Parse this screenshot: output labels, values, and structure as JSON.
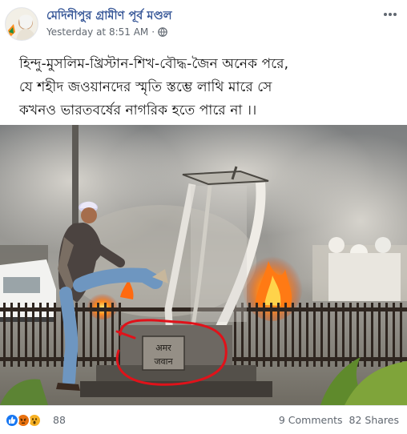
{
  "post": {
    "page_name": "মেদিনীপুর গ্রামীণ পূর্ব মণ্ডল",
    "timestamp": "Yesterday at 8:51 AM",
    "separator": "·",
    "audience_icon": "globe-icon",
    "menu_icon": "more-options-icon"
  },
  "banner": {
    "lines": [
      "হিন্দু-মুসলিম-খ্রিস্টান-শিখ-বৌদ্ধ-জৈন অনেক পরে,",
      "যে শহীদ জওয়ানদের স্মৃতি স্তম্ভে লাথি মারে সে",
      "কখনও ভারতবর্ষের নাগরিক হতে পারে না ।।"
    ]
  },
  "photo": {
    "plaque_line1": "अमर",
    "plaque_line2": "जवान"
  },
  "footer": {
    "reaction_icons": [
      "like-icon",
      "angry-icon",
      "wow-icon"
    ],
    "reaction_count": "88",
    "comments": "9 Comments",
    "shares": "82 Shares"
  },
  "colors": {
    "link_blue": "#385898",
    "meta_gray": "#606770",
    "like_blue": "#1877f2",
    "angry_orange": "#e9710f",
    "wow_yellow": "#f7b125",
    "annotation_red": "#e0121a"
  }
}
